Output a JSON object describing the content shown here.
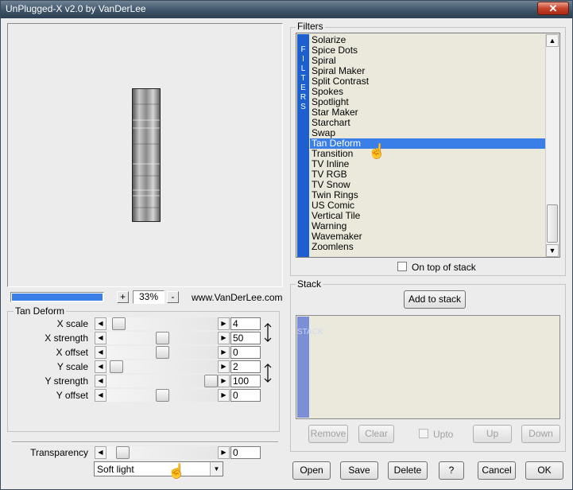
{
  "window": {
    "title": "UnPlugged-X v2.0 by VanDerLee",
    "close_icon": "close-icon"
  },
  "preview": {
    "zoom_minus": "-",
    "zoom_plus": "+",
    "zoom_value": "33%",
    "website": "www.VanDerLee.com",
    "progress": 1.0
  },
  "filters": {
    "group_label": "Filters",
    "vertical_tab": "FILTERS",
    "items": [
      "Solarize",
      "Spice Dots",
      "Spiral",
      "Spiral Maker",
      "Split Contrast",
      "Spokes",
      "Spotlight",
      "Star Maker",
      "Starchart",
      "Swap",
      "Tan Deform",
      "Transition",
      "TV Inline",
      "TV RGB",
      "TV Snow",
      "Twin Rings",
      "US Comic",
      "Vertical Tile",
      "Warning",
      "Wavemaker",
      "Zoomlens"
    ],
    "selected": "Tan Deform",
    "on_top_label": "On top of stack"
  },
  "params": {
    "group_label": "Tan Deform",
    "sliders": [
      {
        "label": "X scale",
        "value": "4",
        "pos": 0.06
      },
      {
        "label": "X strength",
        "value": "50",
        "pos": 0.5
      },
      {
        "label": "X offset",
        "value": "0",
        "pos": 0.5
      },
      {
        "label": "Y scale",
        "value": "2",
        "pos": 0.03
      },
      {
        "label": "Y strength",
        "value": "100",
        "pos": 1.0
      },
      {
        "label": "Y offset",
        "value": "0",
        "pos": 0.5
      }
    ]
  },
  "transparency": {
    "label": "Transparency",
    "value": "0",
    "pos": 0.1
  },
  "blend": {
    "selected": "Soft light"
  },
  "stack": {
    "group_label": "Stack",
    "add_button": "Add to stack",
    "vertical_tab": "STACK",
    "remove": "Remove",
    "clear": "Clear",
    "upto": "Upto",
    "up": "Up",
    "down": "Down"
  },
  "footer": {
    "open": "Open",
    "save": "Save",
    "delete": "Delete",
    "help": "?",
    "cancel": "Cancel",
    "ok": "OK"
  },
  "colors": {
    "accent": "#3a7ee8",
    "tab_blue": "#1e5fd0",
    "stack_tab": "#7b8fd6",
    "list_bg": "#ebe9dc"
  }
}
